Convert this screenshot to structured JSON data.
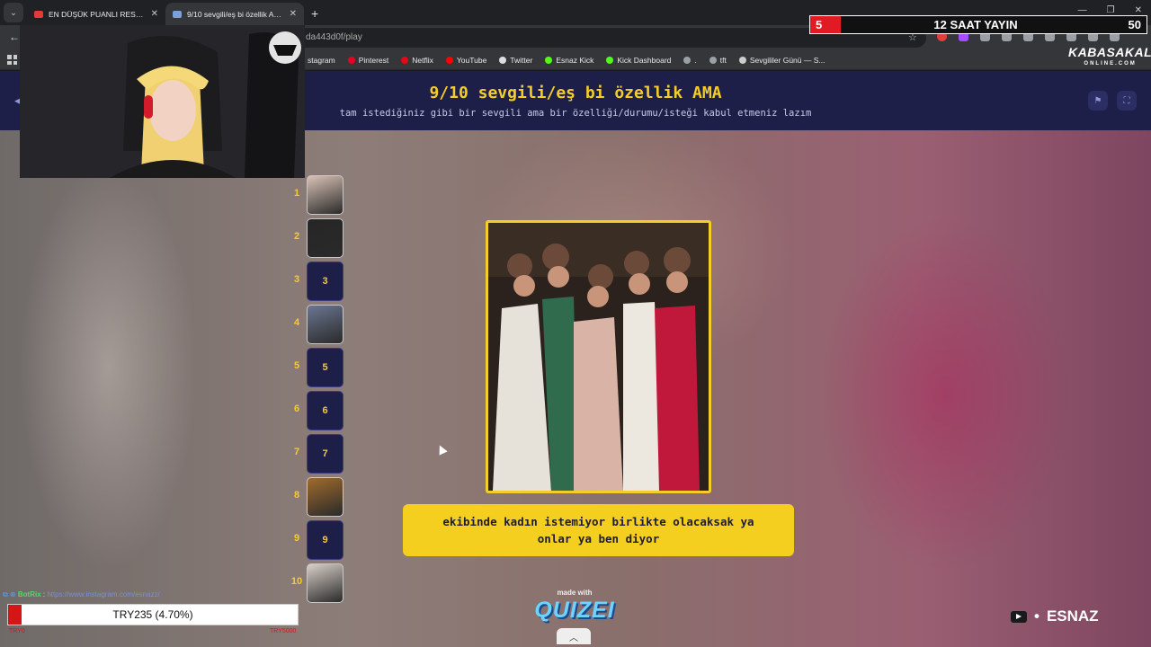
{
  "browser": {
    "tabs": [
      {
        "title": "EN DÜŞÜK PUANLI RESTORANL",
        "active": false,
        "favicon_color": "#e53935"
      },
      {
        "title": "9/10 sevgili/eş bi özellik AMA",
        "active": true,
        "favicon_color": "#7aa0d8"
      }
    ],
    "address": "da443d0f/play",
    "bookmarks": [
      {
        "label": "stagram",
        "icon_color": "#d6249f"
      },
      {
        "label": "Pinterest",
        "icon_color": "#e60023"
      },
      {
        "label": "Netflix",
        "icon_color": "#e50914"
      },
      {
        "label": "YouTube",
        "icon_color": "#ff0000"
      },
      {
        "label": "Twitter",
        "icon_color": "#dddddd"
      },
      {
        "label": "Esnaz Kick",
        "icon_color": "#53fc18"
      },
      {
        "label": "Kick Dashboard",
        "icon_color": "#53fc18"
      },
      {
        "label": ".",
        "icon_color": "#9aa0a6"
      },
      {
        "label": "tft",
        "icon_color": "#9aa0a6"
      },
      {
        "label": "Sevgililer Günü — S...",
        "icon_color": "#cccccc"
      }
    ]
  },
  "quiz": {
    "title": "9/10 sevgili/eş bi özellik AMA",
    "subtitle": "tam istediğiniz gibi bir sevgili ama bir özelliği/durumu/isteği kabul etmeniz lazım",
    "answer": "ekibinde kadın istemiyor birlikte olacaksak ya onlar ya ben diyor",
    "made_with": "made with",
    "brand": "QUIZEI",
    "ranks": [
      {
        "num": "1",
        "label": "",
        "thumb": "#d9c2b5"
      },
      {
        "num": "2",
        "label": "",
        "thumb": "#262626"
      },
      {
        "num": "3",
        "label": "3",
        "thumb": ""
      },
      {
        "num": "4",
        "label": "",
        "thumb": "#6b7692"
      },
      {
        "num": "5",
        "label": "5",
        "thumb": ""
      },
      {
        "num": "6",
        "label": "6",
        "thumb": ""
      },
      {
        "num": "7",
        "label": "7",
        "thumb": ""
      },
      {
        "num": "8",
        "label": "",
        "thumb": "#a06b2c"
      },
      {
        "num": "9",
        "label": "9",
        "thumb": ""
      },
      {
        "num": "10",
        "label": "",
        "thumb": "#d8cfc8"
      }
    ]
  },
  "stream": {
    "counter_left": "5",
    "counter_title": "12 SAAT YAYIN",
    "counter_right": "50",
    "sponsor_top": "KABASAKAL",
    "sponsor_bottom": "ONLINE.COM",
    "chat_user": "BotRix",
    "chat_text": "https://www.instagram.com/esnazz/",
    "donation_label": "TRY235 (4.70%)",
    "donation_fraction": 0.047,
    "donation_min": "TRY0",
    "donation_max": "TRY5000",
    "channel": "ESNAZ",
    "colors": {
      "accent_yellow": "#f4cd2a",
      "header_navy": "#1d1f48",
      "alert_red": "#e01b24"
    }
  }
}
